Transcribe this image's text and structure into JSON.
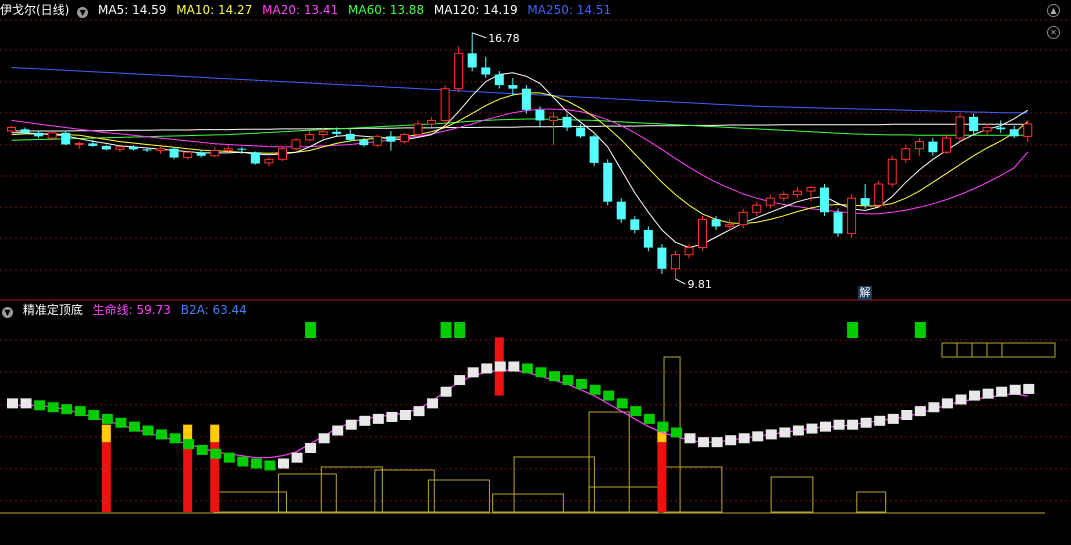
{
  "main_panel": {
    "title": "伊戈尔(日线)",
    "menu_icon": "chevron-down-icon",
    "indicators": [
      {
        "label": "MA5: 14.59",
        "color": "#ffffff"
      },
      {
        "label": "MA10: 14.27",
        "color": "#ffff40"
      },
      {
        "label": "MA20: 13.41",
        "color": "#ff40ff"
      },
      {
        "label": "MA60: 13.88",
        "color": "#40ff40"
      },
      {
        "label": "MA120: 14.19",
        "color": "#ffffff"
      },
      {
        "label": "MA250: 14.51",
        "color": "#4060ff"
      }
    ],
    "high_label": "16.78",
    "low_label": "9.81",
    "unlock_badge": "解",
    "window_controls": [
      "up-arrow-icon",
      "cross-icon"
    ]
  },
  "sub_panel": {
    "title": "精准定顶底",
    "menu_icon": "chevron-down-icon",
    "indicators": [
      {
        "label": "生命线: 59.73",
        "color": "#ff40ff"
      },
      {
        "label": "B2A: 63.44",
        "color": "#4080ff"
      }
    ]
  },
  "colors": {
    "up": "#ff3232",
    "down": "#54ffff",
    "grid": "#7a1010",
    "separator": "#b01818",
    "ma5": "#ffffff",
    "ma10": "#ffff40",
    "ma20": "#ff40ff",
    "ma60": "#40ff40",
    "ma250": "#4060ff",
    "blocks_green": "#00cc00",
    "blocks_white": "#e8e8e8",
    "signal_red": "#ee1111",
    "signal_yellow": "#ffcc00",
    "volume_profile": "#b8a830"
  },
  "chart_data": {
    "type": "candlestick",
    "ylim": [
      9.5,
      17.2
    ],
    "candles": [
      [
        14.0,
        14.15,
        13.95,
        14.1
      ],
      [
        14.05,
        14.1,
        13.9,
        13.95
      ],
      [
        13.95,
        14.0,
        13.8,
        13.85
      ],
      [
        13.8,
        14.0,
        13.75,
        13.95
      ],
      [
        13.95,
        13.98,
        13.6,
        13.62
      ],
      [
        13.62,
        13.7,
        13.5,
        13.65
      ],
      [
        13.65,
        13.75,
        13.55,
        13.58
      ],
      [
        13.58,
        13.6,
        13.45,
        13.48
      ],
      [
        13.48,
        13.6,
        13.4,
        13.55
      ],
      [
        13.55,
        13.6,
        13.45,
        13.48
      ],
      [
        13.48,
        13.52,
        13.4,
        13.45
      ],
      [
        13.45,
        13.55,
        13.35,
        13.5
      ],
      [
        13.5,
        13.55,
        13.2,
        13.25
      ],
      [
        13.25,
        13.45,
        13.2,
        13.4
      ],
      [
        13.4,
        13.45,
        13.25,
        13.3
      ],
      [
        13.3,
        13.55,
        13.25,
        13.45
      ],
      [
        13.45,
        13.6,
        13.4,
        13.5
      ],
      [
        13.5,
        13.55,
        13.35,
        13.48
      ],
      [
        13.4,
        13.42,
        13.05,
        13.08
      ],
      [
        13.1,
        13.25,
        13.0,
        13.2
      ],
      [
        13.2,
        13.55,
        13.15,
        13.5
      ],
      [
        13.5,
        13.8,
        13.45,
        13.75
      ],
      [
        13.75,
        14.0,
        13.7,
        13.9
      ],
      [
        13.9,
        14.1,
        13.8,
        13.98
      ],
      [
        13.98,
        14.1,
        13.85,
        13.92
      ],
      [
        13.92,
        14.05,
        13.7,
        13.75
      ],
      [
        13.75,
        13.8,
        13.55,
        13.6
      ],
      [
        13.6,
        13.9,
        13.55,
        13.85
      ],
      [
        13.85,
        14.0,
        13.45,
        13.7
      ],
      [
        13.7,
        13.95,
        13.65,
        13.9
      ],
      [
        13.9,
        14.3,
        13.85,
        14.2
      ],
      [
        14.2,
        14.4,
        14.1,
        14.3
      ],
      [
        14.3,
        15.3,
        14.2,
        15.2
      ],
      [
        15.2,
        16.4,
        15.1,
        16.2
      ],
      [
        16.2,
        16.78,
        15.7,
        15.8
      ],
      [
        15.8,
        16.1,
        15.5,
        15.6
      ],
      [
        15.6,
        15.7,
        15.2,
        15.3
      ],
      [
        15.3,
        15.5,
        15.0,
        15.2
      ],
      [
        15.2,
        15.3,
        14.5,
        14.6
      ],
      [
        14.6,
        14.7,
        14.1,
        14.3
      ],
      [
        14.3,
        14.55,
        13.6,
        14.4
      ],
      [
        14.4,
        14.5,
        14.0,
        14.1
      ],
      [
        14.1,
        14.2,
        13.8,
        13.85
      ],
      [
        13.85,
        13.9,
        13.0,
        13.1
      ],
      [
        13.1,
        13.2,
        11.9,
        12.0
      ],
      [
        12.0,
        12.1,
        11.4,
        11.5
      ],
      [
        11.5,
        11.6,
        11.1,
        11.2
      ],
      [
        11.2,
        11.3,
        10.6,
        10.7
      ],
      [
        10.7,
        10.8,
        9.95,
        10.1
      ],
      [
        10.1,
        10.6,
        9.81,
        10.5
      ],
      [
        10.5,
        10.8,
        10.4,
        10.7
      ],
      [
        10.7,
        11.6,
        10.6,
        11.5
      ],
      [
        11.5,
        11.6,
        11.2,
        11.3
      ],
      [
        11.3,
        11.5,
        11.2,
        11.35
      ],
      [
        11.35,
        11.8,
        11.25,
        11.7
      ],
      [
        11.7,
        12.0,
        11.6,
        11.9
      ],
      [
        11.9,
        12.2,
        11.8,
        12.1
      ],
      [
        12.1,
        12.3,
        12.0,
        12.2
      ],
      [
        12.2,
        12.4,
        12.1,
        12.3
      ],
      [
        12.3,
        12.45,
        12.0,
        12.4
      ],
      [
        12.4,
        12.5,
        11.6,
        11.7
      ],
      [
        11.7,
        11.8,
        11.0,
        11.1
      ],
      [
        11.1,
        12.2,
        11.0,
        12.1
      ],
      [
        12.1,
        12.5,
        11.8,
        11.9
      ],
      [
        11.9,
        12.6,
        11.85,
        12.5
      ],
      [
        12.5,
        13.3,
        12.4,
        13.2
      ],
      [
        13.2,
        13.6,
        13.1,
        13.5
      ],
      [
        13.5,
        13.8,
        13.3,
        13.7
      ],
      [
        13.7,
        13.8,
        13.3,
        13.4
      ],
      [
        13.4,
        13.9,
        13.35,
        13.8
      ],
      [
        13.8,
        14.5,
        13.7,
        14.4
      ],
      [
        14.4,
        14.5,
        13.9,
        14.0
      ],
      [
        14.0,
        14.2,
        13.9,
        14.1
      ],
      [
        14.1,
        14.3,
        13.95,
        14.05
      ],
      [
        14.05,
        14.15,
        13.8,
        13.85
      ],
      [
        13.85,
        14.3,
        13.7,
        14.2
      ]
    ],
    "ma5": [
      13.95,
      13.95,
      13.92,
      13.9,
      13.87,
      13.78,
      13.71,
      13.65,
      13.58,
      13.55,
      13.52,
      13.49,
      13.45,
      13.42,
      13.38,
      13.38,
      13.38,
      13.4,
      13.35,
      13.33,
      13.35,
      13.4,
      13.55,
      13.75,
      13.85,
      13.88,
      13.85,
      13.82,
      13.78,
      13.75,
      13.82,
      13.9,
      14.15,
      14.55,
      15.0,
      15.4,
      15.6,
      15.65,
      15.55,
      15.35,
      14.95,
      14.55,
      14.25,
      13.95,
      13.55,
      12.9,
      12.25,
      11.7,
      11.2,
      10.85,
      10.7,
      10.8,
      11.0,
      11.2,
      11.4,
      11.55,
      11.7,
      11.85,
      12.0,
      12.1,
      12.15,
      11.95,
      11.8,
      11.75,
      11.85,
      12.15,
      12.55,
      12.9,
      13.2,
      13.45,
      13.7,
      13.9,
      14.05,
      14.15,
      14.35,
      14.59
    ],
    "ma10": [
      13.9,
      13.92,
      13.92,
      13.92,
      13.9,
      13.88,
      13.82,
      13.76,
      13.7,
      13.66,
      13.62,
      13.58,
      13.54,
      13.5,
      13.46,
      13.44,
      13.42,
      13.4,
      13.38,
      13.37,
      13.38,
      13.4,
      13.45,
      13.55,
      13.65,
      13.72,
      13.76,
      13.8,
      13.82,
      13.84,
      13.9,
      13.98,
      14.1,
      14.28,
      14.5,
      14.72,
      14.9,
      15.02,
      15.08,
      15.08,
      15.0,
      14.85,
      14.65,
      14.4,
      14.1,
      13.75,
      13.35,
      12.95,
      12.55,
      12.2,
      11.9,
      11.65,
      11.5,
      11.4,
      11.38,
      11.42,
      11.5,
      11.6,
      11.72,
      11.82,
      11.9,
      11.92,
      11.9,
      11.88,
      11.88,
      11.95,
      12.1,
      12.3,
      12.55,
      12.8,
      13.05,
      13.3,
      13.52,
      13.72,
      13.95,
      14.27
    ],
    "ma20": [
      14.3,
      14.25,
      14.2,
      14.15,
      14.1,
      14.05,
      14.0,
      13.95,
      13.92,
      13.88,
      13.84,
      13.8,
      13.76,
      13.72,
      13.68,
      13.64,
      13.62,
      13.6,
      13.58,
      13.56,
      13.55,
      13.55,
      13.56,
      13.58,
      13.6,
      13.62,
      13.66,
      13.7,
      13.75,
      13.8,
      13.85,
      13.92,
      14.0,
      14.1,
      14.2,
      14.32,
      14.42,
      14.52,
      14.58,
      14.62,
      14.62,
      14.6,
      14.55,
      14.45,
      14.32,
      14.15,
      13.95,
      13.72,
      13.48,
      13.22,
      12.98,
      12.75,
      12.55,
      12.38,
      12.22,
      12.1,
      12.0,
      11.92,
      11.86,
      11.8,
      11.76,
      11.72,
      11.68,
      11.66,
      11.66,
      11.7,
      11.76,
      11.84,
      11.94,
      12.06,
      12.2,
      12.36,
      12.54,
      12.74,
      12.96,
      13.41
    ],
    "ma60": [
      13.74,
      13.75,
      13.76,
      13.77,
      13.78,
      13.79,
      13.8,
      13.81,
      13.82,
      13.83,
      13.84,
      13.85,
      13.86,
      13.87,
      13.88,
      13.89,
      13.9,
      13.92,
      13.94,
      13.96,
      13.98,
      14.0,
      14.02,
      14.04,
      14.06,
      14.08,
      14.1,
      14.12,
      14.14,
      14.16,
      14.18,
      14.2,
      14.22,
      14.25,
      14.28,
      14.3,
      14.32,
      14.33,
      14.34,
      14.34,
      14.33,
      14.32,
      14.31,
      14.3,
      14.28,
      14.26,
      14.24,
      14.22,
      14.2,
      14.18,
      14.16,
      14.14,
      14.12,
      14.1,
      14.08,
      14.06,
      14.04,
      14.02,
      14.0,
      13.98,
      13.96,
      13.94,
      13.92,
      13.91,
      13.9,
      13.89,
      13.89,
      13.88,
      13.88,
      13.88,
      13.88,
      13.88,
      13.88,
      13.88,
      13.88,
      13.88
    ],
    "ma120": [
      14.0,
      14.0,
      14.0,
      14.0,
      14.0,
      14.01,
      14.01,
      14.01,
      14.02,
      14.02,
      14.02,
      14.03,
      14.03,
      14.03,
      14.04,
      14.04,
      14.04,
      14.05,
      14.05,
      14.05,
      14.06,
      14.06,
      14.06,
      14.07,
      14.07,
      14.07,
      14.08,
      14.08,
      14.08,
      14.09,
      14.09,
      14.09,
      14.1,
      14.1,
      14.1,
      14.11,
      14.11,
      14.11,
      14.12,
      14.12,
      14.12,
      14.13,
      14.13,
      14.13,
      14.14,
      14.14,
      14.14,
      14.15,
      14.15,
      14.15,
      14.16,
      14.16,
      14.16,
      14.17,
      14.17,
      14.17,
      14.17,
      14.18,
      14.18,
      14.18,
      14.18,
      14.18,
      14.18,
      14.18,
      14.18,
      14.19,
      14.19,
      14.19,
      14.19,
      14.19,
      14.19,
      14.19,
      14.19,
      14.19,
      14.19,
      14.19
    ],
    "ma250": [
      15.8,
      15.78,
      15.76,
      15.74,
      15.72,
      15.7,
      15.68,
      15.66,
      15.64,
      15.62,
      15.6,
      15.58,
      15.56,
      15.54,
      15.52,
      15.5,
      15.48,
      15.46,
      15.44,
      15.42,
      15.4,
      15.38,
      15.36,
      15.34,
      15.32,
      15.3,
      15.28,
      15.26,
      15.24,
      15.22,
      15.2,
      15.18,
      15.16,
      15.14,
      15.12,
      15.1,
      15.08,
      15.06,
      15.04,
      15.02,
      15.0,
      14.98,
      14.96,
      14.94,
      14.92,
      14.9,
      14.88,
      14.86,
      14.84,
      14.82,
      14.8,
      14.78,
      14.76,
      14.74,
      14.72,
      14.7,
      14.69,
      14.68,
      14.67,
      14.66,
      14.65,
      14.64,
      14.63,
      14.62,
      14.61,
      14.6,
      14.59,
      14.58,
      14.57,
      14.56,
      14.55,
      14.54,
      14.53,
      14.52,
      14.52,
      14.51
    ],
    "indicator": {
      "ylim": [
        0,
        100
      ],
      "b2a": [
        56,
        56,
        55,
        54,
        53,
        52,
        50,
        48,
        46,
        44,
        42,
        40,
        38,
        35,
        32,
        30,
        28,
        26,
        25,
        24,
        25,
        28,
        33,
        38,
        42,
        45,
        47,
        48,
        49,
        50,
        52,
        56,
        62,
        68,
        72,
        74,
        75,
        75,
        74,
        72,
        70,
        68,
        66,
        63,
        60,
        56,
        52,
        48,
        44,
        41,
        38,
        36,
        36,
        37,
        38,
        39,
        40,
        41,
        42,
        43,
        44,
        45,
        45,
        46,
        47,
        48,
        50,
        52,
        54,
        56,
        58,
        60,
        61,
        62,
        63,
        63.44
      ],
      "b2a_color": [
        "w",
        "w",
        "g",
        "g",
        "g",
        "g",
        "g",
        "g",
        "g",
        "g",
        "g",
        "g",
        "g",
        "g",
        "g",
        "g",
        "g",
        "g",
        "g",
        "g",
        "w",
        "w",
        "w",
        "w",
        "w",
        "w",
        "w",
        "w",
        "w",
        "w",
        "w",
        "w",
        "w",
        "w",
        "w",
        "w",
        "w",
        "w",
        "g",
        "g",
        "g",
        "g",
        "g",
        "g",
        "g",
        "g",
        "g",
        "g",
        "g",
        "g",
        "w",
        "w",
        "w",
        "w",
        "w",
        "w",
        "w",
        "w",
        "w",
        "w",
        "w",
        "w",
        "w",
        "w",
        "w",
        "w",
        "w",
        "w",
        "w",
        "w",
        "w",
        "w",
        "w",
        "w",
        "w",
        "w"
      ],
      "lifeline": [
        55,
        55,
        55,
        54,
        53,
        51,
        49,
        47,
        45,
        43,
        41,
        39,
        37,
        35,
        33,
        31,
        30,
        29,
        28,
        28,
        29,
        31,
        35,
        39,
        43,
        46,
        48,
        49,
        50,
        51,
        53,
        57,
        62,
        67,
        70,
        72,
        73,
        73,
        72,
        70,
        68,
        66,
        63,
        60,
        56,
        52,
        48,
        44,
        41,
        39,
        37,
        36,
        36,
        37,
        38,
        39,
        40,
        41,
        42,
        43,
        44,
        44,
        45,
        46,
        47,
        48,
        49,
        51,
        53,
        55,
        57,
        58,
        59,
        60,
        61,
        59.73
      ],
      "green_top_signals": [
        22,
        32,
        33,
        62,
        67
      ],
      "bottom_signals": [
        7,
        13,
        15,
        48
      ],
      "volume_profile": [
        [
          0.55,
          0.98,
          25
        ],
        [
          0.55,
          0.8,
          100
        ],
        [
          0.62,
          0.98,
          45
        ],
        [
          0.62,
          0.72,
          155
        ],
        [
          0.72,
          0.98,
          35
        ],
        [
          0.48,
          0.98,
          55
        ],
        [
          0.8,
          0.98,
          20
        ],
        [
          0.2,
          0.65,
          20
        ],
        [
          0.26,
          0.62,
          38
        ],
        [
          0.3,
          0.68,
          45
        ],
        [
          0.35,
          0.72,
          42
        ],
        [
          0.4,
          0.78,
          32
        ],
        [
          0.46,
          0.9,
          18
        ]
      ]
    },
    "indicator_extra_text": "",
    "indicator_boxes": 5
  }
}
